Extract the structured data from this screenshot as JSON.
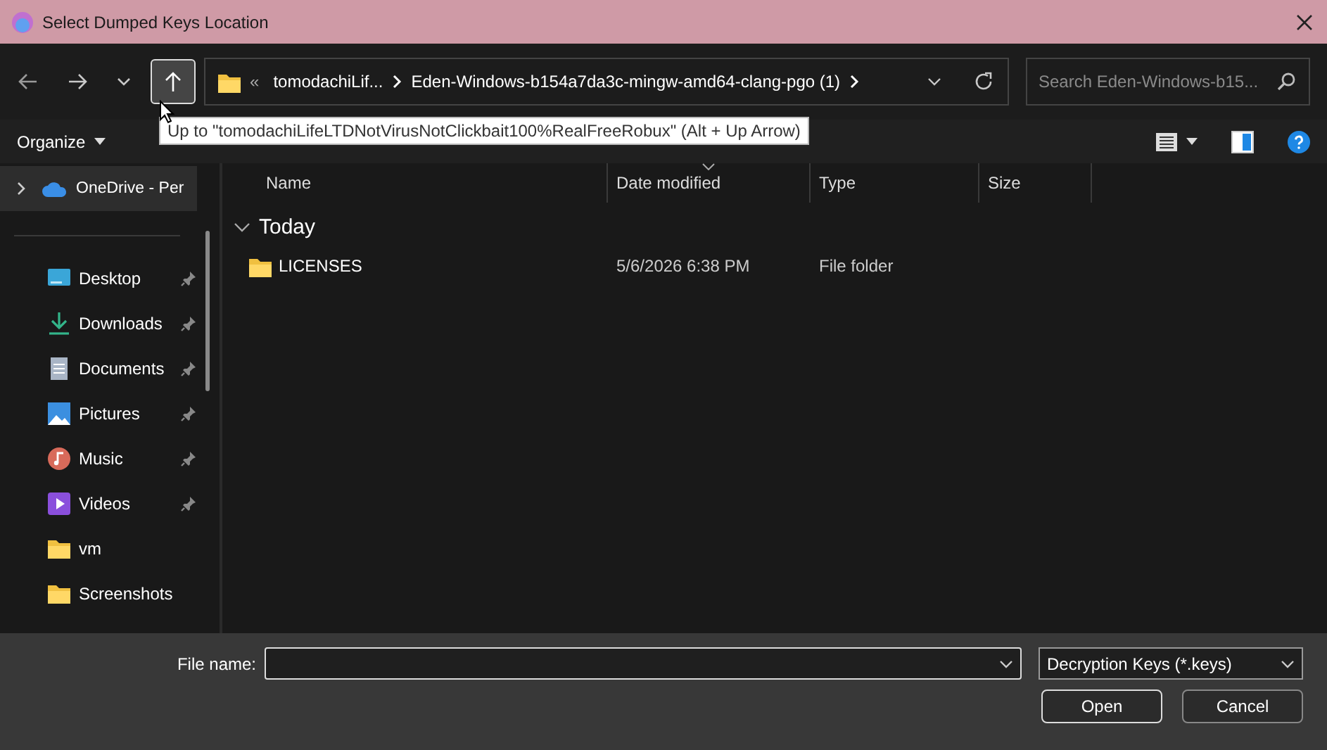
{
  "window": {
    "title": "Select Dumped Keys Location"
  },
  "address": {
    "overflow": "«",
    "segments": [
      "tomodachiLif...",
      "Eden-Windows-b154a7da3c-mingw-amd64-clang-pgo (1)"
    ]
  },
  "search": {
    "placeholder": "Search Eden-Windows-b15..."
  },
  "tooltip": "Up to \"tomodachiLifeLTDNotVirusNotClickbait100%RealFreeRobux\" (Alt + Up Arrow)",
  "commands": [
    "Organize"
  ],
  "sidebar": {
    "top": {
      "label": "OneDrive - Per",
      "expanded": false,
      "selected": true
    },
    "items": [
      {
        "label": "Desktop",
        "kind": "desktop",
        "pinned": true
      },
      {
        "label": "Downloads",
        "kind": "downloads",
        "pinned": true
      },
      {
        "label": "Documents",
        "kind": "documents",
        "pinned": true
      },
      {
        "label": "Pictures",
        "kind": "pictures",
        "pinned": true
      },
      {
        "label": "Music",
        "kind": "music",
        "pinned": true
      },
      {
        "label": "Videos",
        "kind": "videos",
        "pinned": true
      },
      {
        "label": "vm",
        "kind": "folder",
        "pinned": false
      },
      {
        "label": "Screenshots",
        "kind": "folder",
        "pinned": false
      }
    ]
  },
  "table": {
    "columns": [
      "Name",
      "Date modified",
      "Type",
      "Size"
    ],
    "groups": [
      {
        "label": "Today",
        "expanded": true,
        "rows": [
          {
            "name": "LICENSES",
            "date": "5/6/2026 6:38 PM",
            "type": "File folder"
          }
        ]
      }
    ]
  },
  "footer": {
    "file_name_label": "File name:",
    "file_type": "Decryption Keys (*.keys)",
    "buttons": [
      "Open",
      "Cancel"
    ]
  }
}
